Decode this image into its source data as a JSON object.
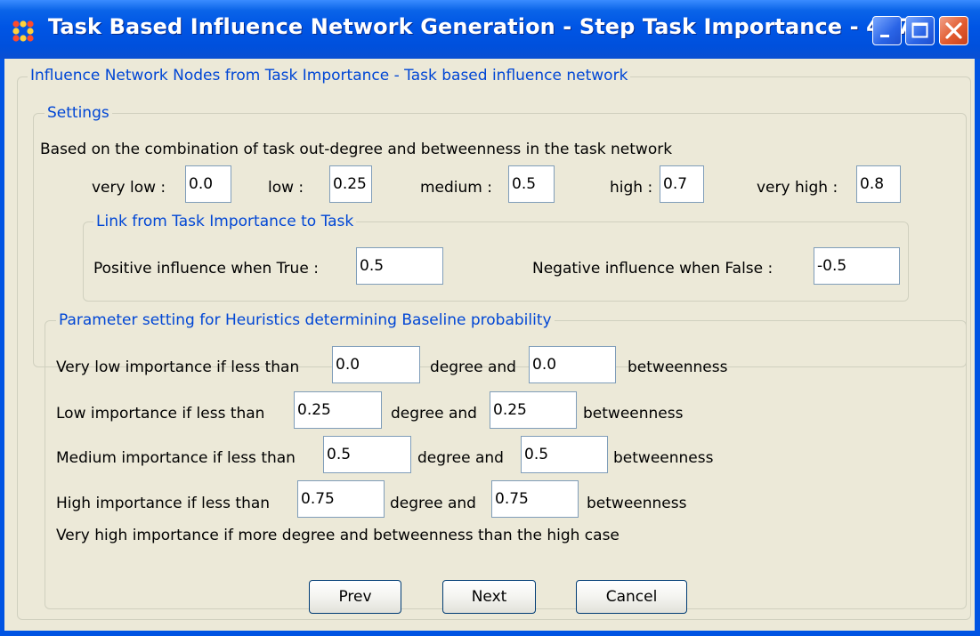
{
  "window": {
    "title": "Task Based Influence Network Generation - Step Task Importance - 4/ 7",
    "controls": {
      "minimize": "minimize-icon",
      "maximize": "maximize-icon",
      "close": "close-icon"
    }
  },
  "main_group": {
    "title": "Influence Network Nodes from Task Importance - Task based influence network"
  },
  "settings": {
    "title": "Settings",
    "description": "Based on the combination of task out-degree and betweenness in the task network",
    "levels": [
      {
        "label": "very low :",
        "value": "0.0"
      },
      {
        "label": "low :",
        "value": "0.25"
      },
      {
        "label": "medium :",
        "value": "0.5"
      },
      {
        "label": "high :",
        "value": "0.7"
      },
      {
        "label": "very high :",
        "value": "0.8"
      }
    ],
    "link": {
      "title": "Link from Task Importance to Task",
      "positive_label": "Positive influence when True :",
      "positive_value": "0.5",
      "negative_label": "Negative influence when False :",
      "negative_value": "-0.5"
    }
  },
  "heuristics": {
    "title": "Parameter setting for Heuristics determining Baseline probability",
    "degree_label": "degree and",
    "betweenness_label": "betweenness",
    "rows": [
      {
        "label": "Very low importance if less than",
        "degree": "0.0",
        "betweenness": "0.0"
      },
      {
        "label": "Low importance if less than",
        "degree": "0.25",
        "betweenness": "0.25"
      },
      {
        "label": "Medium importance if less than",
        "degree": "0.5",
        "betweenness": "0.5"
      },
      {
        "label": "High importance if less than",
        "degree": "0.75",
        "betweenness": "0.75"
      }
    ],
    "note": "Very high importance if more degree and betweenness than the high case"
  },
  "buttons": {
    "prev": "Prev",
    "next": "Next",
    "cancel": "Cancel"
  },
  "colors": {
    "titlebar": "#0054e3",
    "group_title": "#0046d5",
    "client_bg": "#ece9d8"
  }
}
